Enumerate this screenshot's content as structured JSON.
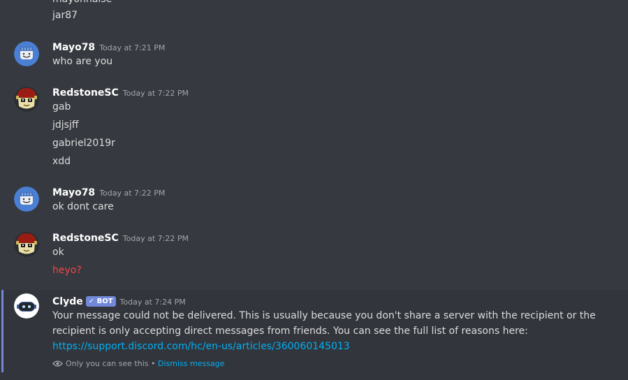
{
  "top_messages": [
    "mayonnaise",
    "jar87"
  ],
  "messages": [
    {
      "username": "Mayo78",
      "timestamp": "Today at 7:21 PM",
      "lines": [
        "who are you"
      ]
    },
    {
      "username": "RedstoneSC",
      "timestamp": "Today at 7:22 PM",
      "lines": [
        "gab",
        "jdjsjff",
        "gabriel2019r",
        "xdd"
      ]
    },
    {
      "username": "Mayo78",
      "timestamp": "Today at 7:22 PM",
      "lines": [
        "ok dont care"
      ]
    },
    {
      "username": "RedstoneSC",
      "timestamp": "Today at 7:22 PM",
      "lines": [
        "ok"
      ],
      "failed_line": "heyo?"
    }
  ],
  "clyde": {
    "username": "Clyde",
    "bot_tag": "✓ BOT",
    "timestamp": "Today at 7:24 PM",
    "text": "Your message could not be delivered. This is usually because you don't share a server with the recipient or the recipient is only accepting direct messages from friends. You can see the full list of reasons here: ",
    "link": "https://support.discord.com/hc/en-us/articles/360060145013",
    "ephemeral_note": "Only you can see this",
    "separator": "•",
    "dismiss_label": "Dismiss message"
  },
  "colors": {
    "background": "#36393f",
    "accent": "#7289da",
    "link": "#00b0f4",
    "failed": "#f04747"
  },
  "icons": [
    "mayo-avatar",
    "redstone-avatar",
    "clyde-avatar",
    "eye-icon"
  ]
}
